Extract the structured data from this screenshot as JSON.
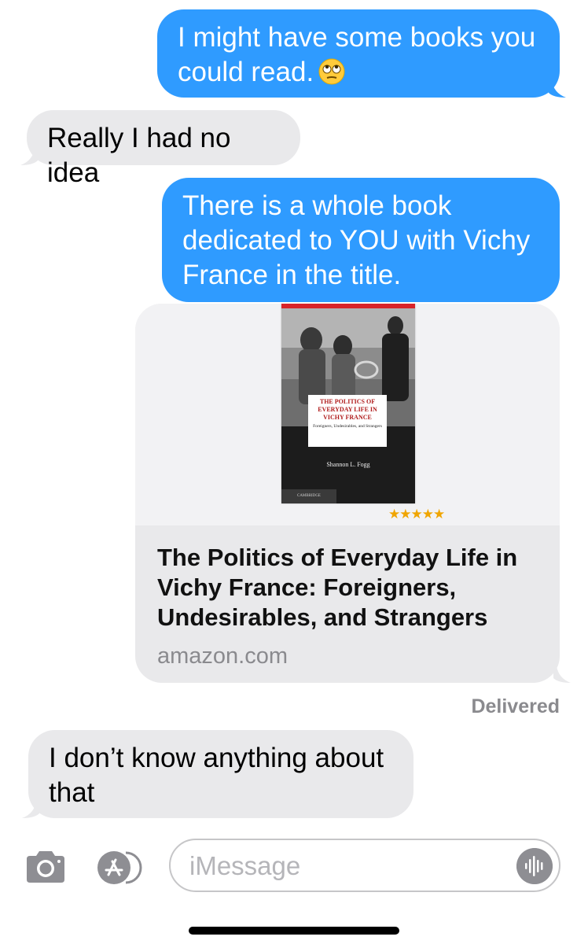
{
  "messages": [
    {
      "direction": "out",
      "text": "I might have some books you could read.",
      "emoji": "eye-roll-emoji"
    },
    {
      "direction": "in",
      "text": "Really I had no idea"
    },
    {
      "direction": "out",
      "text": "There is a whole book dedicated to YOU with Vichy France in the title."
    },
    {
      "direction": "in",
      "text": "I don’t know anything about that"
    }
  ],
  "link_preview": {
    "title": "The Politics of Everyday Life in Vichy France: Foreigners, Undesirables, and Strangers",
    "domain": "amazon.com",
    "rating_stars": "★★★★★",
    "book_cover": {
      "title": "THE POLITICS OF EVERYDAY LIFE IN VICHY FRANCE",
      "subtitle": "Foreigners, Undesirables, and Strangers",
      "author": "Shannon L. Fogg",
      "publisher": "CAMBRIDGE"
    }
  },
  "status": {
    "delivered": "Delivered"
  },
  "input": {
    "placeholder": "iMessage",
    "value": ""
  },
  "icons": {
    "camera": "camera-icon",
    "apps": "app-store-icon",
    "audio": "audio-waveform-icon"
  },
  "colors": {
    "outgoing_bubble": "#2f9bff",
    "incoming_bubble": "#e9e9eb",
    "secondary_text": "#8a8a8e"
  }
}
